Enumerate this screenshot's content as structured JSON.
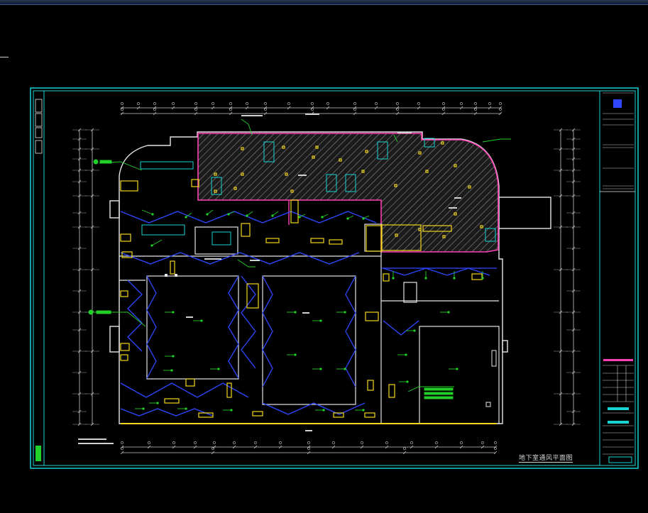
{
  "colors": {
    "background": "#000000",
    "frame": "#19d3d3",
    "wall": "#e6e6e6",
    "duct": "#2f47ff",
    "equipment": "#f2d61d",
    "hatch": "#8a8a8a",
    "zone_boundary": "#ff3fb4",
    "leader": "#22d02a",
    "dimension": "#c8c8c8"
  },
  "drawing": {
    "title_caption": "地下室通风平面图"
  }
}
